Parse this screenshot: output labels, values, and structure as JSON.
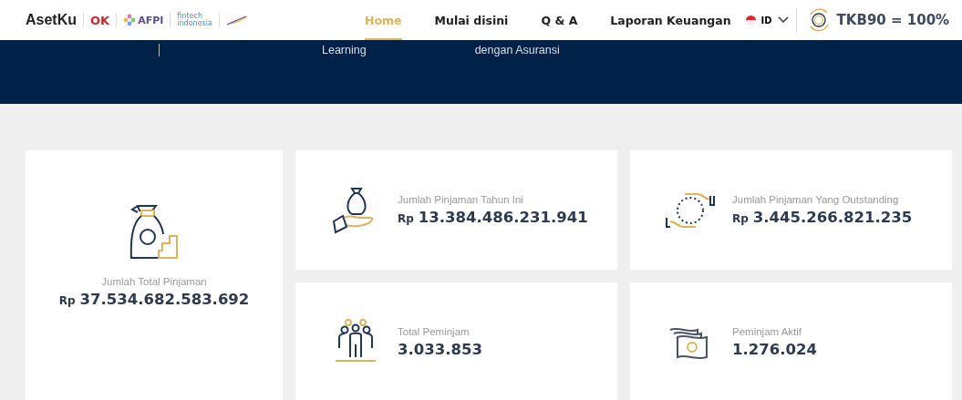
{
  "header": {
    "brand": "AsetKu",
    "partners": [
      {
        "kind": "ojk",
        "text": "OK"
      },
      {
        "kind": "afpi",
        "text": "AFPI"
      },
      {
        "kind": "fintech",
        "text": "fintech",
        "sub": "indonesia"
      },
      {
        "kind": "swoosh"
      }
    ],
    "nav": [
      {
        "label": "Home",
        "selected": true
      },
      {
        "label": "Mulai disini",
        "selected": false
      },
      {
        "label": "Q & A",
        "selected": false
      },
      {
        "label": "Laporan Keuangan",
        "selected": false
      }
    ],
    "language": "ID",
    "tkb": "TKB90 = 100%"
  },
  "banner": {
    "items": [
      "Learning",
      "dengan Asuransi"
    ]
  },
  "stats": [
    {
      "kind": "bag-coins",
      "label": "Jumlah Total Pinjaman",
      "currency": "Rp",
      "value": "37.534.682.583.692"
    },
    {
      "kind": "hand-bag",
      "label": "Jumlah Pinjaman Tahun Ini",
      "currency": "Rp",
      "value": "13.384.486.231.941"
    },
    {
      "kind": "hands-exchange",
      "label": "Jumlah Pinjaman Yang Outstanding",
      "currency": "Rp",
      "value": "3.445.266.821.235"
    },
    {
      "kind": "people",
      "label": "Total Peminjam",
      "value": "3.033.853"
    },
    {
      "kind": "banknotes",
      "label": "Peminjam Aktif",
      "value": "1.276.024"
    }
  ]
}
